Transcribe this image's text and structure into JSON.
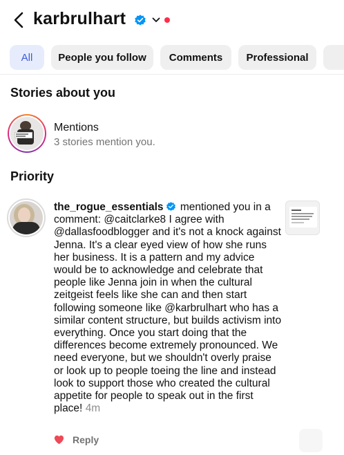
{
  "header": {
    "username": "karbrulhart",
    "verified_icon": "verified-badge-icon",
    "accent_blue": "#0095f6",
    "notification_dot_color": "#ff2d4a"
  },
  "filters": {
    "chips": [
      {
        "label": "All",
        "active": true
      },
      {
        "label": "People you follow",
        "active": false
      },
      {
        "label": "Comments",
        "active": false
      },
      {
        "label": "Professional",
        "active": false
      }
    ]
  },
  "stories_section": {
    "title": "Stories about you",
    "mentions_title": "Mentions",
    "mentions_subtitle": "3 stories mention you."
  },
  "priority_section": {
    "title": "Priority",
    "notification": {
      "username": "the_rogue_essentials",
      "action": " mentioned you in a comment: ",
      "comment": "@caitclarke8 I agree with @dallasfoodblogger and it's not a knock against Jenna. It's a clear eyed view of how she runs her business. It is a pattern and my advice would be to acknowledge and celebrate that people like Jenna join in when the cultural zeitgeist feels like she can and then start following someone like @karbrulhart who has a similar content structure, but builds activism into everything. Once you start doing that the differences become extremely pronounced. We need everyone, but we shouldn't overly praise or look up to people toeing the line and instead look to support those who created the cultural appetite for people to speak out in the first place!",
      "time": "4m",
      "reply_label": "Reply",
      "like_color": "#ed4956"
    }
  }
}
